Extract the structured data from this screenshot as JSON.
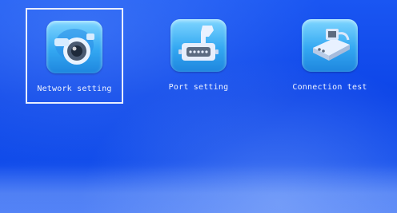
{
  "menu": {
    "items": [
      {
        "label": "Network setting",
        "icon": "camera-icon",
        "selected": true
      },
      {
        "label": "Port setting",
        "icon": "serial-port-icon",
        "selected": false
      },
      {
        "label": "Connection test",
        "icon": "connection-test-icon",
        "selected": false
      }
    ]
  },
  "colors": {
    "background": "#0d45e8",
    "tile": "#34a8f2",
    "label": "#eef3ff",
    "selection_border": "#e8eeff"
  }
}
